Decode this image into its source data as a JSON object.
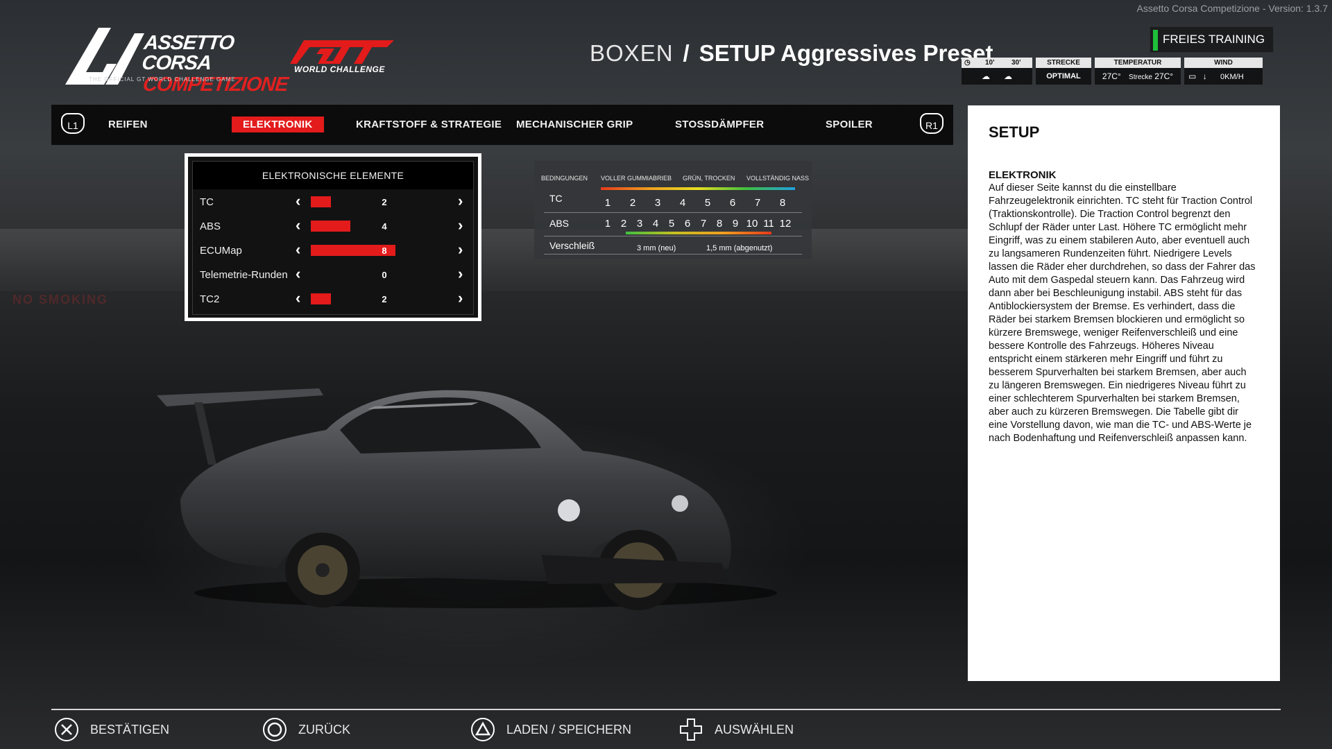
{
  "app": {
    "version": "Assetto Corsa Competizione - Version: 1.3.7",
    "logo_line1": "ASSETTO CORSA",
    "logo_line2": "COMPETIZIONE",
    "logo_tagline": "THE OFFICIAL GT WORLD CHALLENGE GAME",
    "gt_logo": "GT",
    "gt_sub": "WORLD CHALLENGE"
  },
  "header": {
    "section": "BOXEN",
    "separator": "/",
    "subtitle": "SETUP Aggressives Preset",
    "session": "FREIES TRAINING"
  },
  "weather": {
    "forecast_10": "10'",
    "forecast_30": "30'",
    "track_label": "STRECKE",
    "track_value": "OPTIMAL",
    "temp_label": "TEMPERATUR",
    "temp_air": "27C°",
    "temp_track_label": "Strecke",
    "temp_track": "27C°",
    "wind_label": "WIND",
    "wind_value": "0KM/H"
  },
  "nav": {
    "left_button": "L1",
    "right_button": "R1",
    "tabs": [
      {
        "label": "REIFEN",
        "active": false
      },
      {
        "label": "ELEKTRONIK",
        "active": true
      },
      {
        "label": "KRAFTSTOFF & STRATEGIE",
        "active": false
      },
      {
        "label": "MECHANISCHER GRIP",
        "active": false
      },
      {
        "label": "STOSSDÄMPFER",
        "active": false
      },
      {
        "label": "SPOILER",
        "active": false
      }
    ]
  },
  "electronics": {
    "title": "ELEKTRONISCHE ELEMENTE",
    "rows": [
      {
        "label": "TC",
        "value": "2",
        "fraction": 0.19
      },
      {
        "label": "ABS",
        "value": "4",
        "fraction": 0.38
      },
      {
        "label": "ECUMap",
        "value": "8",
        "fraction": 0.81
      },
      {
        "label": "Telemetrie-Runden",
        "value": "0",
        "fraction": 0
      },
      {
        "label": "TC2",
        "value": "2",
        "fraction": 0.19
      }
    ]
  },
  "reference": {
    "conditions": [
      "BEDINGUNGEN",
      "VOLLER GUMMIABRIEB",
      "GRÜN, TROCKEN",
      "VOLLSTÄNDIG NASS"
    ],
    "tc_label": "TC",
    "tc_values": [
      "1",
      "2",
      "3",
      "4",
      "5",
      "6",
      "7",
      "8"
    ],
    "abs_label": "ABS",
    "abs_values": [
      "1",
      "2",
      "3",
      "4",
      "5",
      "6",
      "7",
      "8",
      "9",
      "10",
      "11",
      "12"
    ],
    "wear_label": "Verschleiß",
    "wear_new": "3 mm (neu)",
    "wear_used": "1,5 mm (abgenutzt)"
  },
  "info": {
    "title": "SETUP",
    "heading": "ELEKTRONIK",
    "body": "Auf dieser Seite kannst du die einstellbare Fahrzeugelektronik einrichten. TC steht für Traction Control (Traktionskontrolle). Die Traction Control begrenzt den Schlupf der Räder unter Last. Höhere TC ermöglicht mehr Eingriff, was zu einem stabileren Auto, aber eventuell auch zu langsameren Rundenzeiten führt. Niedrigere Levels lassen die Räder eher durchdrehen, so dass der Fahrer das Auto mit dem Gaspedal steuern kann. Das Fahrzeug wird dann aber bei Beschleunigung instabil. ABS steht für das Antiblockiersystem der Bremse. Es verhindert, dass die Räder bei starkem Bremsen blockieren und ermöglicht so kürzere Bremswege, weniger Reifenverschleiß und eine bessere Kontrolle des Fahrzeugs. Höheres Niveau entspricht einem stärkeren mehr Eingriff und führt zu besserem Spurverhalten bei starkem Bremsen, aber auch zu längeren Bremswegen. Ein niedrigeres Niveau führt zu einer schlechterem Spurverhalten bei starkem Bremsen, aber auch zu kürzeren Bremswegen. Die Tabelle gibt dir eine Vorstellung davon, wie man die TC- und ABS-Werte je nach Bodenhaftung und Reifenverschleiß anpassen kann."
  },
  "footer": {
    "confirm": "BESTÄTIGEN",
    "back": "ZURÜCK",
    "load_save": "LADEN / SPEICHERN",
    "select": "AUSWÄHLEN"
  },
  "background": {
    "sign": "NO SMOKING"
  },
  "colors": {
    "accent": "#e31b1b",
    "session_indicator": "#1fbf3a",
    "panel_bg": "#121213"
  }
}
